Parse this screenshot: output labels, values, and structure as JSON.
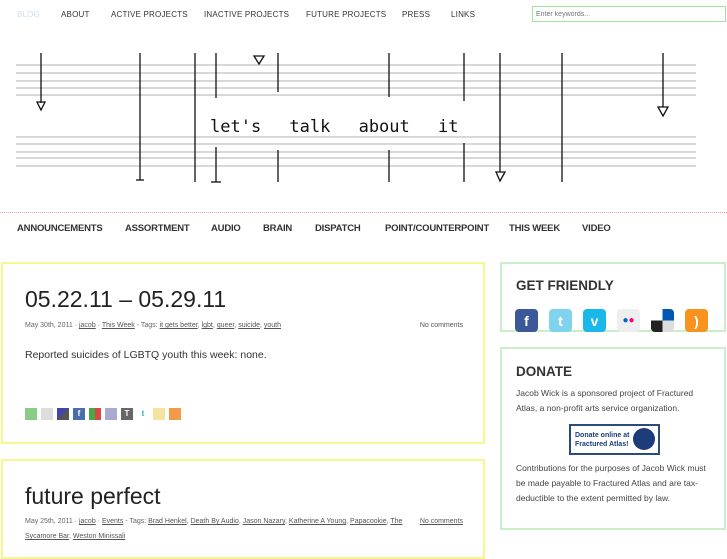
{
  "topnav": {
    "items": [
      {
        "label": "BLOG",
        "active": true
      },
      {
        "label": "ABOUT"
      },
      {
        "label": "ACTIVE PROJECTS"
      },
      {
        "label": "INACTIVE PROJECTS"
      },
      {
        "label": "FUTURE PROJECTS"
      },
      {
        "label": "PRESS"
      },
      {
        "label": "LINKS"
      }
    ],
    "search": {
      "placeholder": "Enter keywords..."
    }
  },
  "banner": {
    "text": "let's talk about it"
  },
  "categories": [
    "ANNOUNCEMENTS",
    "ASSORTMENT",
    "AUDIO",
    "BRAIN",
    "DISPATCH",
    "POINT/COUNTERPOINT",
    "THIS WEEK",
    "VIDEO"
  ],
  "posts": [
    {
      "title": "05.22.11 – 05.29.11",
      "date": "May 30th, 2011",
      "author": "jacob",
      "category": "This Week",
      "tags_label": "Tags:",
      "tags": [
        "it gets better",
        "lgbt",
        "queer",
        "suicide",
        "youth"
      ],
      "comments": "No comments",
      "body": "Reported suicides of LGBTQ youth this week: none."
    },
    {
      "title": "future perfect",
      "date": "May 25th, 2011",
      "author": "jacob",
      "category": "Events",
      "tags_label": "Tags:",
      "tags": [
        "Brad Henkel",
        "Death By Audio",
        "Jason Nazary",
        "Katherine A Young",
        "Papacookie",
        "The Sycamore Bar",
        "Weston Minissali"
      ],
      "comments": "No comments"
    }
  ],
  "share_icons": [
    "print-icon",
    "digg-icon",
    "delicious-icon",
    "facebook-icon",
    "google-icon",
    "email-icon",
    "tumblr-icon",
    "twitter-icon",
    "diigo-icon",
    "rss-icon"
  ],
  "sidebar": {
    "friendly": {
      "title": "GET FRIENDLY",
      "icons": [
        "facebook",
        "twitter",
        "vimeo",
        "flickr",
        "delicious",
        "rss"
      ]
    },
    "donate": {
      "title": "DONATE",
      "text1": "Jacob Wick is a sponsored project of Fractured Atlas, a non-profit arts service organization.",
      "button_line1": "Donate online at",
      "button_line2": "Fractured Atlas!",
      "seal": "ATLAS",
      "text2": "Contributions for the purposes of Jacob Wick must be made payable to Fractured Atlas and are tax-deductible to the extent permitted by law."
    }
  },
  "colors": {
    "post_border": "#f7f78a",
    "widget_border": "#c8f0c8",
    "divider": "#f0a0a0",
    "search_border": "#9de89d"
  }
}
